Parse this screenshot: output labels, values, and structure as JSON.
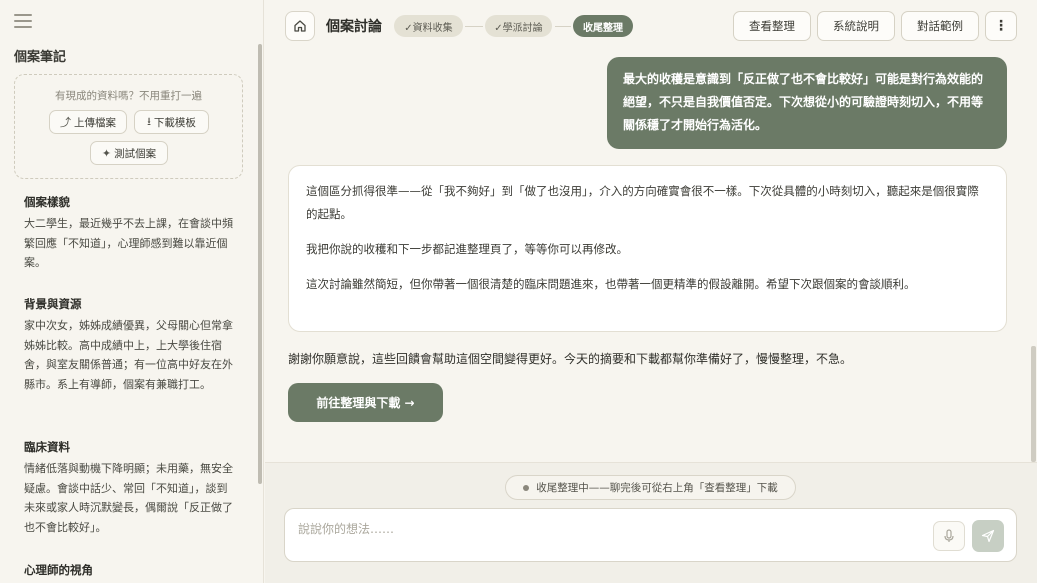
{
  "sidebar": {
    "title": "個案筆記",
    "upload_hint": "有現成的資料嗎？不用重打一遍",
    "upload_button": "上傳檔案",
    "download_template_button": "下載模板",
    "test_case_button": "測試個案",
    "sections": [
      {
        "heading": "個案樣貌",
        "body": "大二學生，最近幾乎不去上課，在會談中頻繁回應「不知道」，心理師感到難以靠近個案。"
      },
      {
        "heading": "背景與資源",
        "body": "家中次女，姊姊成績優異，父母關心但常拿姊姊比較。高中成績中上，上大學後住宿舍，與室友關係普通；有一位高中好友在外縣市。系上有導師，個案有兼職打工。"
      },
      {
        "heading": "臨床資料",
        "body": "情緒低落與動機下降明顯；未用藥，無安全疑慮。會談中話少、常回「不知道」，談到未來或家人時沉默變長，偶爾說「反正做了也不會比較好」。"
      },
      {
        "heading": "心理師的視角",
        "body": ""
      }
    ]
  },
  "header": {
    "title": "個案討論",
    "steps": [
      {
        "label": "✓資料收集",
        "state": "done"
      },
      {
        "label": "✓學派討論",
        "state": "done"
      },
      {
        "label": "收尾整理",
        "state": "active"
      }
    ],
    "view_summary_button": "查看整理",
    "system_help_button": "系統說明",
    "dialog_example_button": "對話範例"
  },
  "chat": {
    "user_message": "最大的收穫是意識到「反正做了也不會比較好」可能是對行為效能的絕望，不只是自我價值否定。下次想從小的可驗證時刻切入，不用等關係穩了才開始行為活化。",
    "ai_paragraphs": [
      "這個區分抓得很準——從「我不夠好」到「做了也沒用」，介入的方向確實會很不一樣。下次從具體的小時刻切入，聽起來是個很實際的起點。",
      "我把你說的收穫和下一步都記進整理頁了，等等你可以再修改。",
      "這次討論雖然簡短，但你帶著一個很清楚的臨床問題進來，也帶著一個更精準的假設離開。希望下次跟個案的會談順利。"
    ],
    "closing_message": "謝謝你願意說，這些回饋會幫助這個空間變得更好。今天的摘要和下載都幫你準備好了，慢慢整理，不急。",
    "cta_button": "前往整理與下載 →"
  },
  "footer": {
    "status_text": "收尾整理中——聊完後可從右上角「查看整理」下載",
    "input_placeholder": "說說你的想法……"
  }
}
